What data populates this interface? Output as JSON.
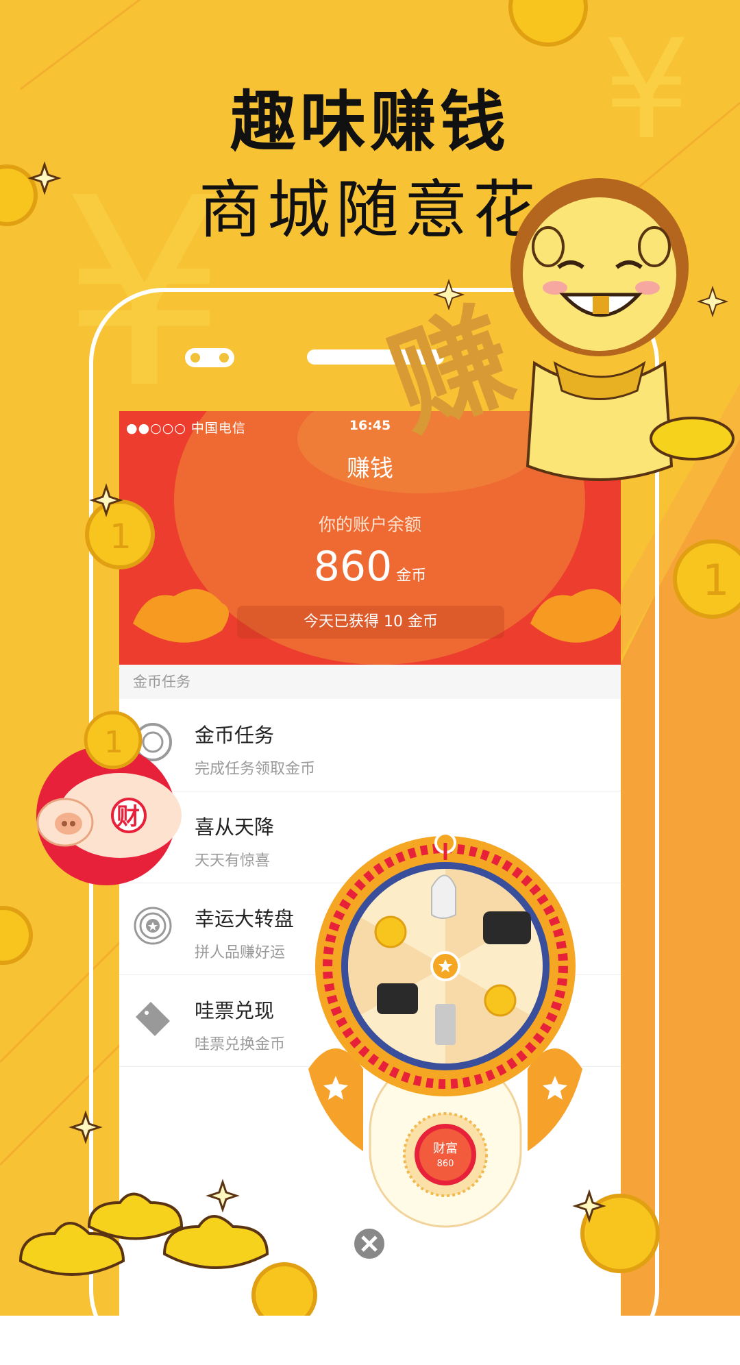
{
  "promo": {
    "headline": "趣味赚钱",
    "subheadline": "商城随意花"
  },
  "status_bar": {
    "carrier": "●●○○○ 中国电信",
    "time": "16:45"
  },
  "header": {
    "title": "赚钱"
  },
  "balance": {
    "label": "你的账户余额",
    "amount": "860",
    "unit": "金币",
    "today_text": "今天已获得 10 金币"
  },
  "section_title": "金币任务",
  "menu_items": [
    {
      "title": "金币任务",
      "subtitle": "完成任务领取金币",
      "icon": "coin-task-icon"
    },
    {
      "title": "喜从天降",
      "subtitle": "天天有惊喜",
      "icon": "surprise-icon"
    },
    {
      "title": "幸运大转盘",
      "subtitle": "拼人品赚好运",
      "icon": "lucky-wheel-icon"
    },
    {
      "title": "哇票兑现",
      "subtitle": "哇票兑换金币",
      "icon": "ticket-icon"
    }
  ],
  "piggy_badge": "财",
  "wheel": {
    "button_label": "财富",
    "button_value": "860"
  },
  "colors": {
    "background": "#f8c235",
    "header_red": "#ec3d2f",
    "coin_gold": "#f7c51e"
  }
}
